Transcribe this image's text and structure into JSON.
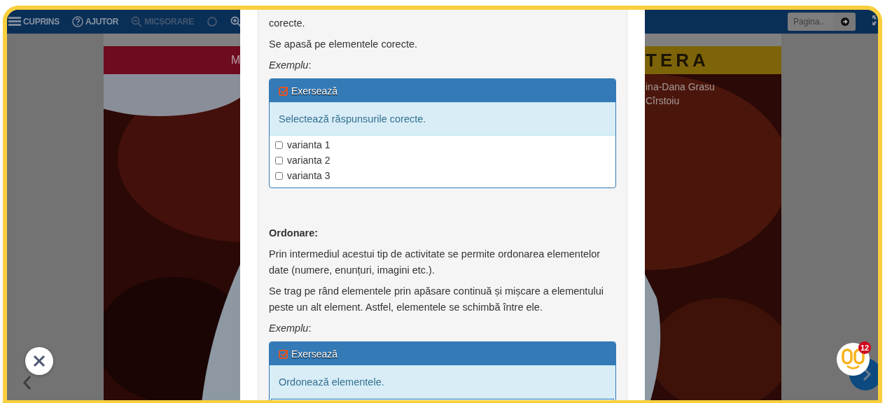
{
  "toolbar": {
    "items": [
      {
        "label": "CUPRINS",
        "disabled": false
      },
      {
        "label": "AJUTOR",
        "disabled": false
      },
      {
        "label": "MICȘORARE",
        "disabled": true
      },
      {
        "disabled": true
      },
      {
        "disabled": false
      }
    ],
    "page_field": {
      "placeholder": "Pagina.."
    }
  },
  "cover": {
    "title_left": "M",
    "title_right": "TERA",
    "authors": [
      "ina-Dana Grasu",
      "Cîrstoiu"
    ]
  },
  "modal": {
    "blocks": [
      {
        "kind": "paragraph",
        "text": "corecte."
      },
      {
        "kind": "paragraph",
        "text": "Se apasă pe elementele corecte."
      },
      {
        "kind": "example",
        "text": "*Exemplu*:"
      },
      {
        "kind": "checklist",
        "header": "Exersează",
        "prompt": "Selectează răspunsurile corecte.",
        "options": [
          {
            "label": "varianta 1",
            "checked": false
          },
          {
            "label": "varianta 2",
            "checked": false
          },
          {
            "label": "varianta 3",
            "checked": false
          }
        ]
      },
      {
        "kind": "heading",
        "text": "Ordonare:"
      },
      {
        "kind": "paragraph",
        "text": "Prin intermediul acestui tip de activitate se permite ordonarea elementelor date (numere, enunțuri, imagini etc.)."
      },
      {
        "kind": "paragraph",
        "text": "Se trag pe rând elementele prin apăsare continuă și mișcare a elementului peste un alt element. Astfel, elementele se schimbă între ele."
      },
      {
        "kind": "example",
        "text": "*Exemplu*:"
      },
      {
        "kind": "sortable",
        "header": "Exersează",
        "prompt": "Ordonează elementele."
      }
    ]
  },
  "mascot": {
    "badge": "12"
  }
}
